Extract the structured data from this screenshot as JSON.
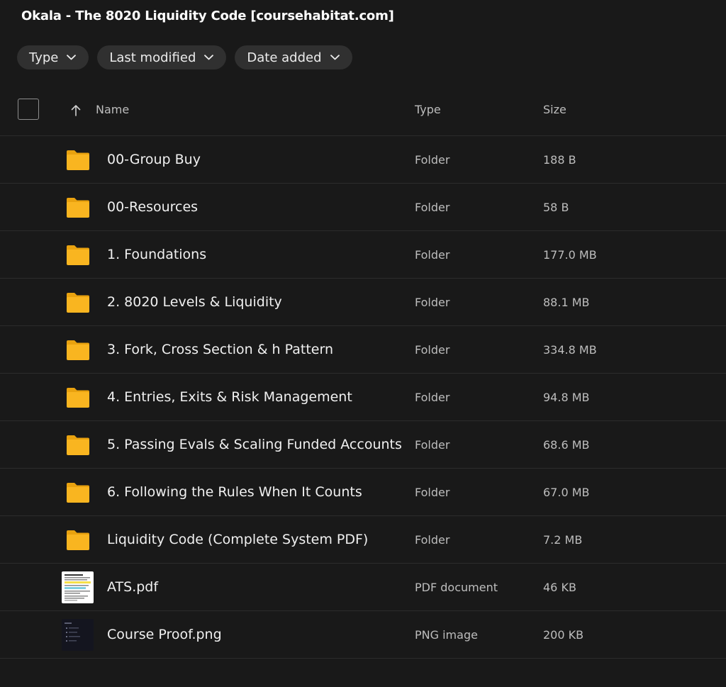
{
  "title": "Okala - The 8020 Liquidity Code [coursehabitat.com]",
  "filters": {
    "type_label": "Type",
    "last_modified_label": "Last modified",
    "date_added_label": "Date added"
  },
  "columns": {
    "name": "Name",
    "type": "Type",
    "size": "Size"
  },
  "colors": {
    "background": "#191919",
    "folder": "#F9B520",
    "chip": "#303030"
  },
  "files": [
    {
      "name": "00-Group Buy",
      "type": "Folder",
      "size": "188 B",
      "icon": "folder-icon"
    },
    {
      "name": "00-Resources",
      "type": "Folder",
      "size": "58 B",
      "icon": "folder-icon"
    },
    {
      "name": "1. Foundations",
      "type": "Folder",
      "size": "177.0 MB",
      "icon": "folder-icon"
    },
    {
      "name": "2. 8020 Levels & Liquidity",
      "type": "Folder",
      "size": "88.1 MB",
      "icon": "folder-icon"
    },
    {
      "name": "3. Fork, Cross Section & h Pattern",
      "type": "Folder",
      "size": "334.8 MB",
      "icon": "folder-icon"
    },
    {
      "name": "4. Entries, Exits & Risk Management",
      "type": "Folder",
      "size": "94.8 MB",
      "icon": "folder-icon"
    },
    {
      "name": "5. Passing Evals & Scaling Funded Accounts",
      "type": "Folder",
      "size": "68.6 MB",
      "icon": "folder-icon"
    },
    {
      "name": "6. Following the Rules When It Counts",
      "type": "Folder",
      "size": "67.0 MB",
      "icon": "folder-icon"
    },
    {
      "name": "Liquidity Code (Complete System PDF)",
      "type": "Folder",
      "size": "7.2 MB",
      "icon": "folder-icon"
    },
    {
      "name": "ATS.pdf",
      "type": "PDF document",
      "size": "46 KB",
      "icon": "pdf-thumbnail"
    },
    {
      "name": "Course Proof.png",
      "type": "PNG image",
      "size": "200 KB",
      "icon": "png-thumbnail"
    }
  ]
}
